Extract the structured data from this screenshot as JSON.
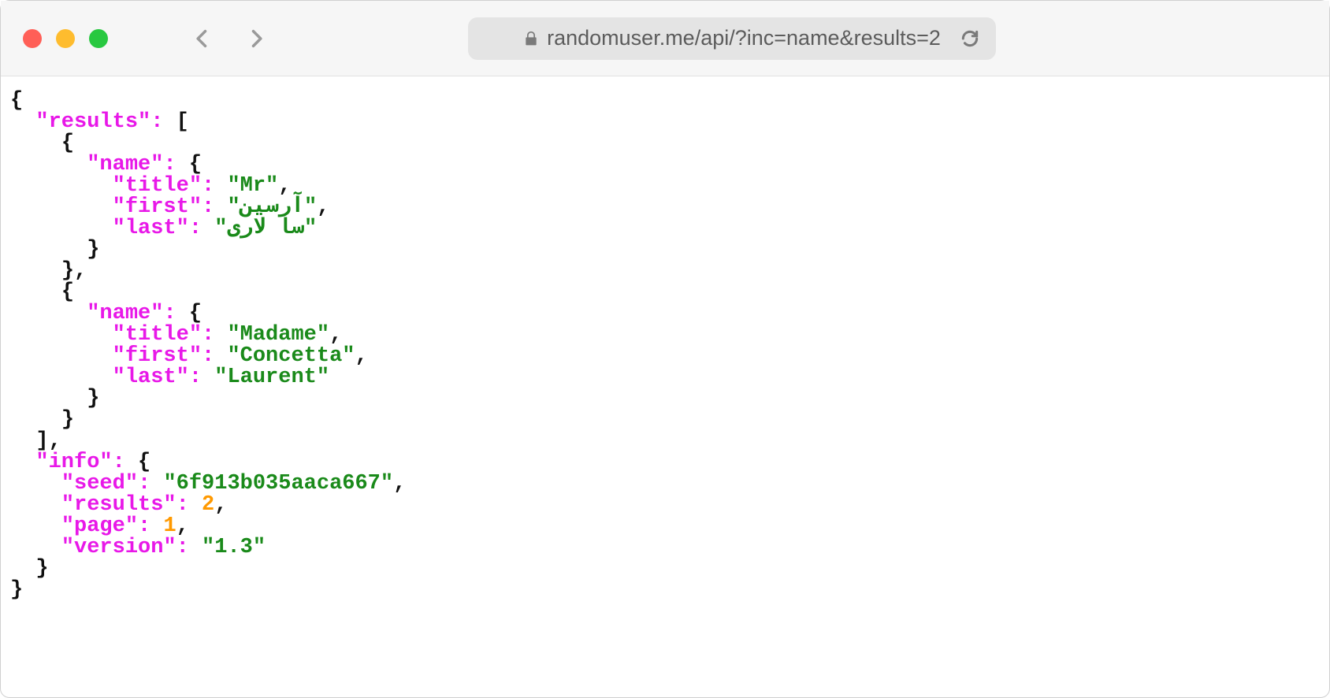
{
  "browser": {
    "url": "randomuser.me/api/?inc=name&results=2"
  },
  "json": {
    "braceOpen": "{",
    "braceClose": "}",
    "bracketOpen": "[",
    "bracketClose": "]",
    "bracketCloseComma": "],",
    "braceCloseComma": "},",
    "comma": ",",
    "keys": {
      "results": "\"results\"",
      "name": "\"name\"",
      "title": "\"title\"",
      "first": "\"first\"",
      "last": "\"last\"",
      "info": "\"info\"",
      "seed": "\"seed\"",
      "resultsCount": "\"results\"",
      "page": "\"page\"",
      "version": "\"version\""
    },
    "values": {
      "person1": {
        "title": "\"Mr\"",
        "first": "\"آرسین\"",
        "last": "\"سا لاری\""
      },
      "person2": {
        "title": "\"Madame\"",
        "first": "\"Concetta\"",
        "last": "\"Laurent\""
      },
      "info": {
        "seed": "\"6f913b035aaca667\"",
        "results": "2",
        "page": "1",
        "version": "\"1.3\""
      }
    },
    "colon": ":"
  }
}
